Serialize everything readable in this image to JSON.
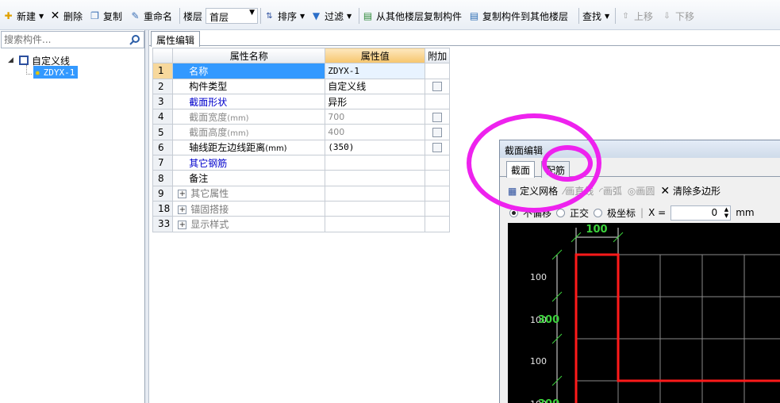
{
  "toolbar": {
    "new": "新建",
    "delete": "删除",
    "copy": "复制",
    "rename": "重命名",
    "floor_label": "楼层",
    "floor_value": "首层",
    "sort": "排序",
    "filter": "过滤",
    "copy_from_floor": "从其他楼层复制构件",
    "copy_to_floor": "复制构件到其他楼层",
    "find": "查找",
    "move_up": "上移",
    "move_down": "下移"
  },
  "left": {
    "search_placeholder": "搜索构件...",
    "tree_root": "自定义线",
    "tree_child": "ZDYX-1"
  },
  "property_tab": "属性编辑",
  "table": {
    "headers": [
      "属性名称",
      "属性值",
      "附加"
    ],
    "rows": [
      {
        "num": "1",
        "name": "名称",
        "value": "ZDYX-1"
      },
      {
        "num": "2",
        "name": "构件类型",
        "value": "自定义线"
      },
      {
        "num": "3",
        "name": "截面形状",
        "value": "异形"
      },
      {
        "num": "4",
        "name": "截面宽度",
        "unit": "(mm)",
        "value": "700"
      },
      {
        "num": "5",
        "name": "截面高度",
        "unit": "(mm)",
        "value": "400"
      },
      {
        "num": "6",
        "name": "轴线距左边线距离",
        "unit": "(mm)",
        "value": "(350)"
      },
      {
        "num": "7",
        "name": "其它钢筋",
        "value": ""
      },
      {
        "num": "8",
        "name": "备注",
        "value": ""
      },
      {
        "num": "9",
        "name": "其它属性",
        "value": ""
      },
      {
        "num": "18",
        "name": "锚固搭接",
        "value": ""
      },
      {
        "num": "33",
        "name": "显示样式",
        "value": ""
      }
    ]
  },
  "section_editor": {
    "title": "截面编辑",
    "tab_section": "截面",
    "tab_rebar": "配筋",
    "define_grid": "定义网格",
    "draw_line": "画直线",
    "draw_arc": "画弧",
    "draw_circle": "画圆",
    "clear_polygon": "清除多边形",
    "opt_no_offset": "不偏移",
    "opt_ortho": "正交",
    "opt_polar": "极坐标",
    "x_label": "X =",
    "x_value": "0",
    "x_unit": "mm",
    "dim_top": "100",
    "dim_left_1": "100",
    "dim_left_2": "100",
    "dim_left_2_overlay": "300",
    "dim_left_3": "100",
    "dim_left_4": "100",
    "dim_left_4_overlay": "300"
  }
}
